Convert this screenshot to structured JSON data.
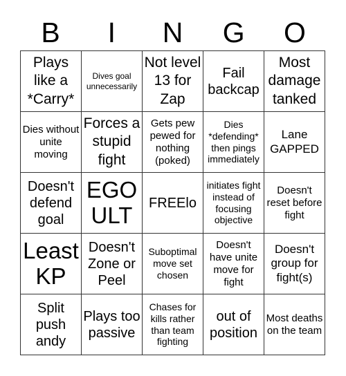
{
  "header": {
    "letters": [
      "B",
      "I",
      "N",
      "G",
      "O"
    ]
  },
  "board": {
    "cells": [
      [
        "Plays like a *Carry*",
        "Dives goal unnecessarily",
        "Not level 13 for Zap",
        "Fail backcap",
        "Most damage tanked"
      ],
      [
        "Dies without unite moving",
        "Forces a stupid fight",
        "Gets pew pewed for nothing (poked)",
        "Dies *defending* then pings immediately",
        "Lane GAPPED"
      ],
      [
        "Doesn't defend goal",
        "EGO ULT",
        "FREElo",
        "initiates fight instead of focusing objective",
        "Doesn't reset before fight"
      ],
      [
        "Least KP",
        "Doesn't Zone or Peel",
        "Suboptimal move set chosen",
        "Doesn't have unite move for fight",
        "Doesn't group for fight(s)"
      ],
      [
        "Split push andy",
        "Plays too passive",
        "Chases for kills rather than team fighting",
        "out of position",
        "Most deaths on the team"
      ]
    ]
  }
}
